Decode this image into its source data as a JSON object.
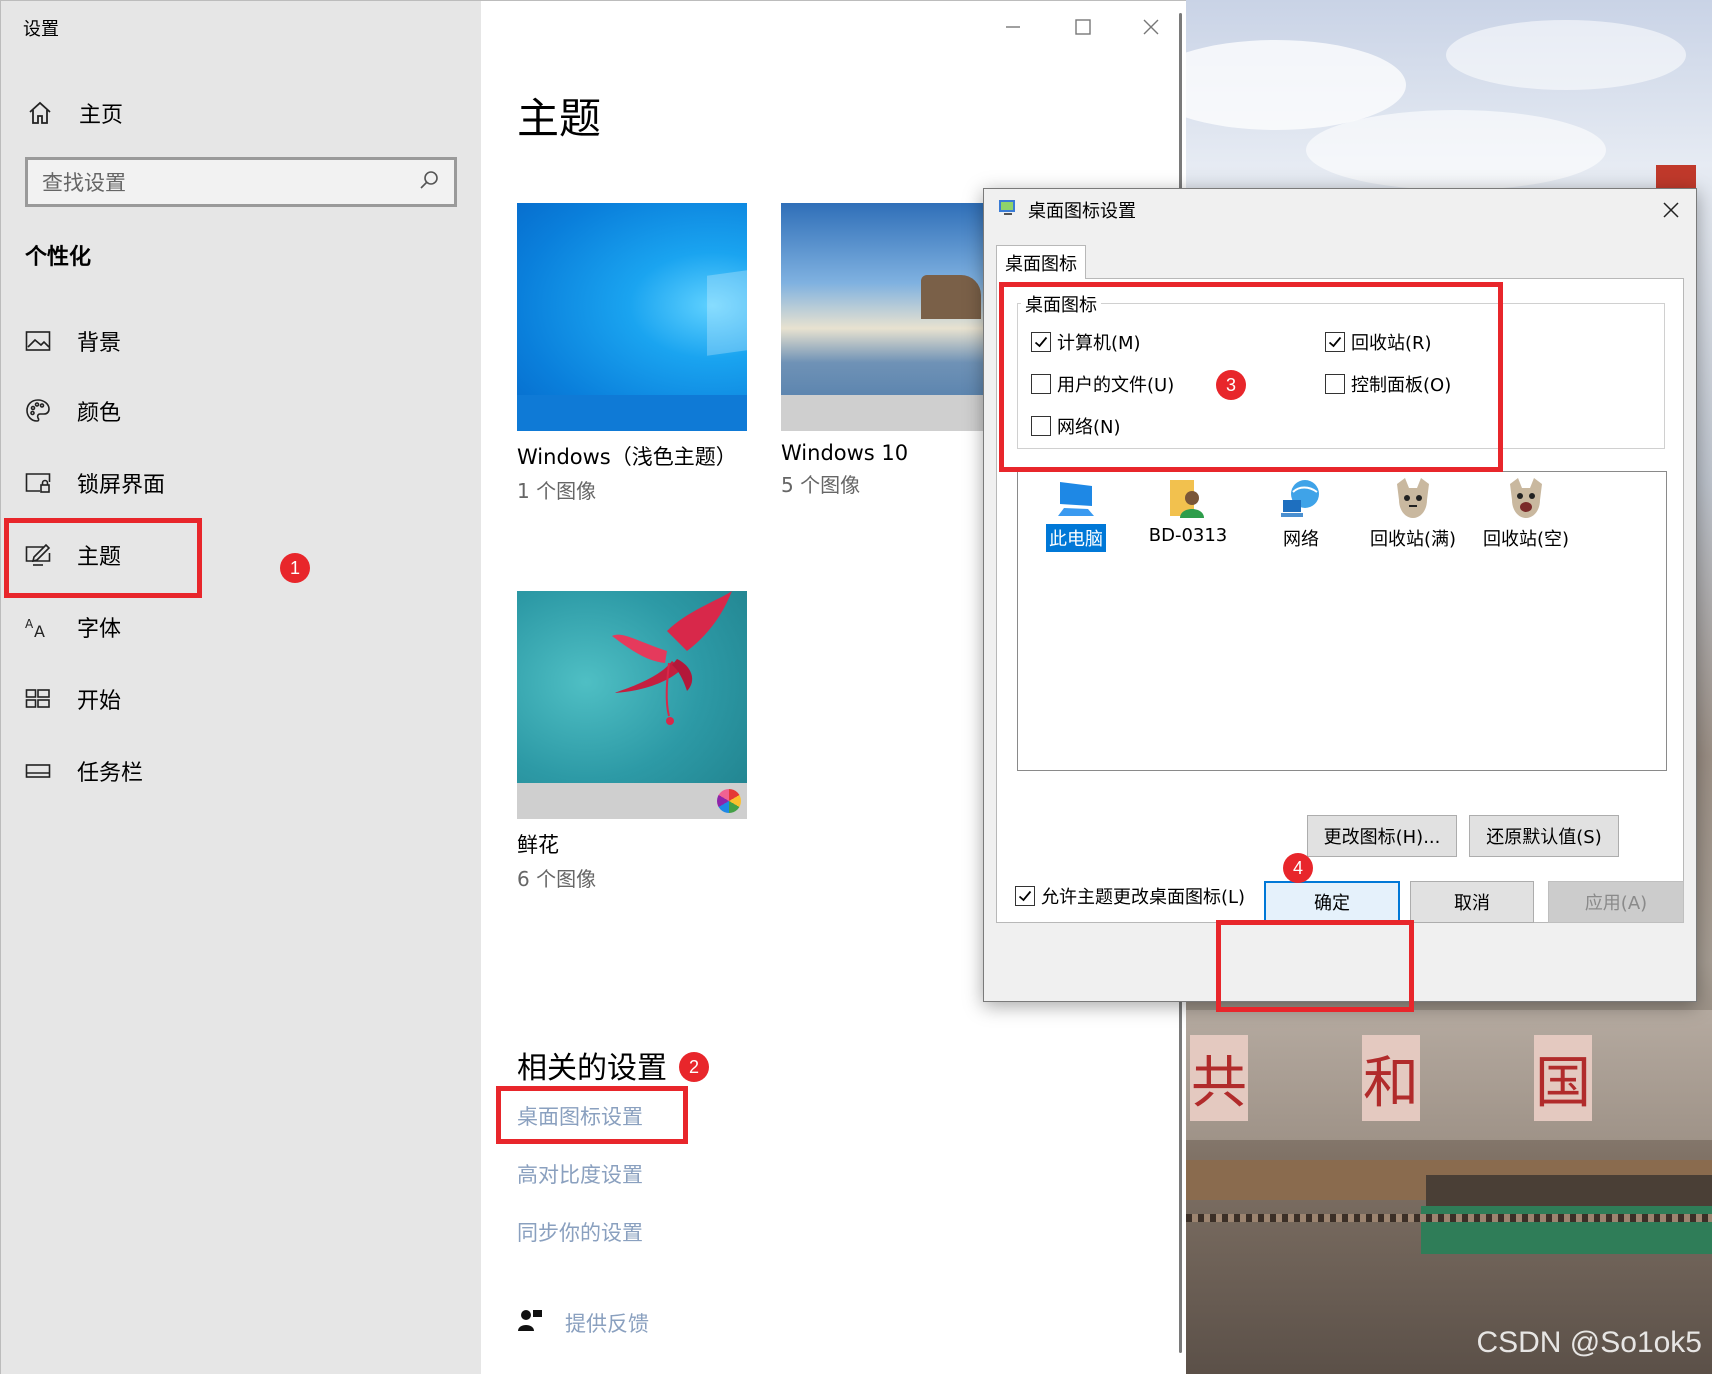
{
  "settings": {
    "title": "设置",
    "home_label": "主页",
    "search_placeholder": "查找设置",
    "section": "个性化",
    "nav": [
      {
        "label": "背景",
        "icon": "image-icon"
      },
      {
        "label": "颜色",
        "icon": "palette-icon"
      },
      {
        "label": "锁屏界面",
        "icon": "lock-screen-icon"
      },
      {
        "label": "主题",
        "icon": "theme-pen-icon"
      },
      {
        "label": "字体",
        "icon": "font-icon"
      },
      {
        "label": "开始",
        "icon": "start-grid-icon"
      },
      {
        "label": "任务栏",
        "icon": "taskbar-icon"
      }
    ],
    "selected_nav": "主题"
  },
  "main": {
    "title": "主题",
    "themes": [
      {
        "name": "Windows（浅色主题）",
        "count": "1 个图像"
      },
      {
        "name": "Windows 10",
        "count": "5 个图像"
      },
      {
        "name": "鲜花",
        "count": "6 个图像"
      }
    ],
    "related_title": "相关的设置",
    "links": [
      "桌面图标设置",
      "高对比度设置",
      "同步你的设置"
    ],
    "feedback": "提供反馈"
  },
  "dialog": {
    "title": "桌面图标设置",
    "tab": "桌面图标",
    "group": "桌面图标",
    "checkboxes": [
      {
        "label": "计算机(M)",
        "checked": true
      },
      {
        "label": "回收站(R)",
        "checked": true
      },
      {
        "label": "用户的文件(U)",
        "checked": false
      },
      {
        "label": "控制面板(O)",
        "checked": false
      },
      {
        "label": "网络(N)",
        "checked": false
      }
    ],
    "icons": [
      {
        "label": "此电脑",
        "icon": "computer-icon",
        "selected": true
      },
      {
        "label": "BD-0313",
        "icon": "user-folder-icon",
        "selected": false
      },
      {
        "label": "网络",
        "icon": "network-globe-icon",
        "selected": false
      },
      {
        "label": "回收站(满)",
        "icon": "recycle-bin-full-icon",
        "selected": false
      },
      {
        "label": "回收站(空)",
        "icon": "recycle-bin-empty-icon",
        "selected": false
      }
    ],
    "change_icon": "更改图标(H)...",
    "restore_default": "还原默认值(S)",
    "allow_themes": {
      "label": "允许主题更改桌面图标(L)",
      "checked": true
    },
    "ok": "确定",
    "cancel": "取消",
    "apply": "应用(A)"
  },
  "annotations": [
    "1",
    "2",
    "3",
    "4"
  ],
  "desktop": {
    "gate_chars": [
      "共",
      "和",
      "国"
    ],
    "watermark": "CSDN @So1ok5"
  },
  "colors": {
    "accent": "#0078d7",
    "annotation_red": "#e8262b",
    "link": "#8aa0bf",
    "sidebar_bg": "#e6e6e6"
  }
}
